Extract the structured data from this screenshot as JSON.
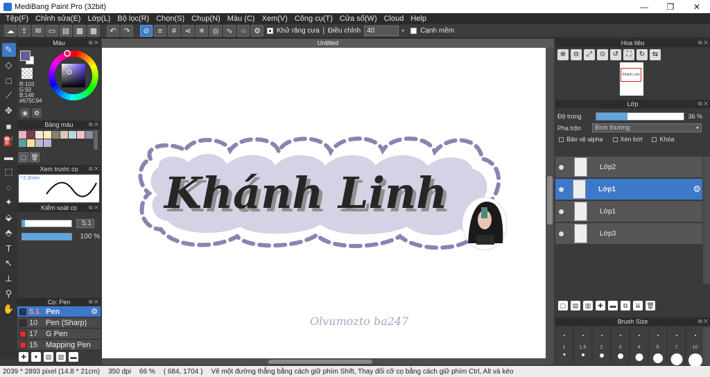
{
  "window": {
    "title": "MediBang Paint Pro (32bit)",
    "minimize": "—",
    "restore": "❐",
    "close": "✕"
  },
  "menu": [
    "Tệp(F)",
    "Chỉnh sửa(E)",
    "Lớp(L)",
    "Bộ lọc(R)",
    "Chọn(S)",
    "Chụp(N)",
    "Màu (C)",
    "Xem(V)",
    "Công cụ(T)",
    "Cửa sổ(W)",
    "Cloud",
    "Help"
  ],
  "toolbar": {
    "antialias_label": "Khử răng cưa",
    "adjust_label": "Điều chỉnh",
    "adjust_value": "40",
    "smooth_label": "Cạnh mềm"
  },
  "color_panel": {
    "title": "Màu",
    "r": "R:103",
    "g": "G:92",
    "b": "B:148",
    "hex": "#675C94",
    "main_color": "#675C94"
  },
  "palette_panel": {
    "title": "Bảng màu",
    "colors": [
      "#e8b4c4",
      "#7a3d52",
      "#f4e6d8",
      "#f6f0b8",
      "#8a8070",
      "#d8c8b8",
      "#b8d8d8",
      "#f4c0c8",
      "#8a90a0",
      "#58a0a0",
      "#f0e0a0",
      "#b8b8c8",
      "#c0b0d8"
    ]
  },
  "brush_preview": {
    "title": "Xem trước cọ",
    "label": "* 0.3/mm"
  },
  "brush_control": {
    "title": "Kiểm soát cọ",
    "size_value": "5.1",
    "opacity_value": "100 %",
    "size_fraction": 0.06,
    "opacity_fraction": 1.0
  },
  "brush_list": {
    "title": "Cọ: Pen",
    "items": [
      {
        "size": "5.1",
        "name": "Pen",
        "color": "#1e3a5a",
        "active": true
      },
      {
        "size": "10",
        "name": "Pen (Sharp)",
        "color": "#333333",
        "active": false
      },
      {
        "size": "17",
        "name": "G Pen",
        "color": "#e03030",
        "active": false
      },
      {
        "size": "15",
        "name": "Mapping Pen",
        "color": "#e03030",
        "active": false
      }
    ]
  },
  "document": {
    "title": "Untitled",
    "main_text": "Khánh Linh",
    "caption": "Olvumozto ba247",
    "badge_color": "#d4d2e4",
    "dash_color": "#8a84b0"
  },
  "navigator": {
    "title": "Hoa tiêu",
    "thumb_text": "Khánh Linh"
  },
  "layer_panel": {
    "title": "Lớp",
    "opacity_label": "Độ trong",
    "opacity_value": "36 %",
    "opacity_fraction": 0.36,
    "blend_label": "Pha trộn",
    "blend_value": "Bình thường",
    "protect_alpha": "Bảo vệ alpha",
    "clipping": "Xén bớt",
    "lock": "Khóa",
    "layers": [
      {
        "name": "Lớp2",
        "active": false
      },
      {
        "name": "Lớp1",
        "active": true
      },
      {
        "name": "Lớp1",
        "active": false
      },
      {
        "name": "Lớp3",
        "active": false
      }
    ]
  },
  "brush_size": {
    "title": "Brush Size",
    "labels": [
      "1",
      "1.5",
      "2",
      "3",
      "4",
      "5",
      "7",
      "10"
    ],
    "dot_sizes": [
      3,
      4,
      6,
      8,
      11,
      14,
      17,
      20
    ]
  },
  "status": {
    "pixels": "2039 * 2893 pixel",
    "cm": "(14.8 * 21cm)",
    "dpi": "350 dpi",
    "zoom": "66 %",
    "coords": "( 684, 1704 )",
    "hint": "Vẽ một đường thẳng bằng cách giữ phím Shift, Thay đổi cỡ cọ bằng cách giữ phím Ctrl, Alt và kéo"
  }
}
